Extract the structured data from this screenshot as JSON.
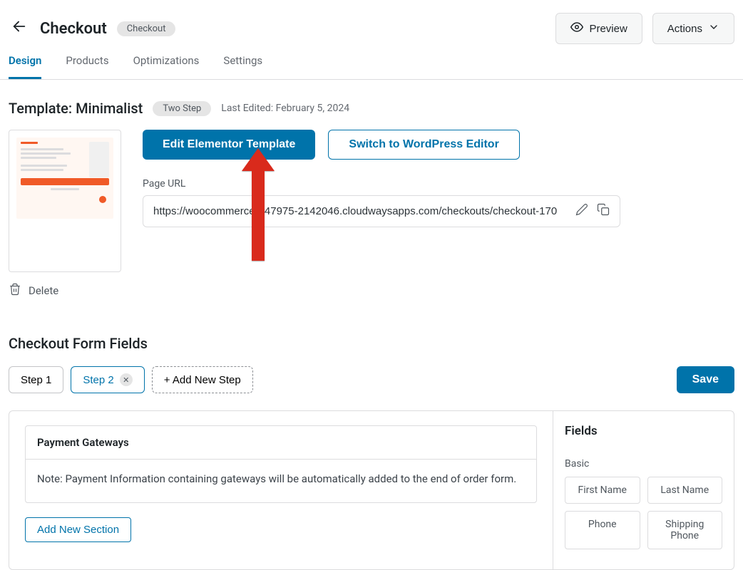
{
  "header": {
    "title": "Checkout",
    "badge": "Checkout",
    "preview_label": "Preview",
    "actions_label": "Actions"
  },
  "tabs": [
    "Design",
    "Products",
    "Optimizations",
    "Settings"
  ],
  "active_tab_index": 0,
  "template": {
    "title": "Template: Minimalist",
    "badge": "Two Step",
    "last_edited": "Last Edited: February 5, 2024",
    "edit_button": "Edit Elementor Template",
    "switch_button": "Switch to WordPress Editor",
    "page_url_label": "Page URL",
    "page_url_value": "https://woocommerce-547975-2142046.cloudwaysapps.com/checkouts/checkout-170",
    "delete_label": "Delete"
  },
  "form_fields": {
    "title": "Checkout Form Fields",
    "steps": [
      "Step 1",
      "Step 2"
    ],
    "active_step_index": 1,
    "add_step_label": "+ Add New Step",
    "save_label": "Save",
    "payment_gateways_title": "Payment Gateways",
    "payment_gateways_note": "Note: Payment Information containing gateways will be automatically added to the end of order form.",
    "add_section_label": "Add New Section",
    "fields_panel_title": "Fields",
    "fields_group": "Basic",
    "field_chips": [
      "First Name",
      "Last Name",
      "Phone",
      "Shipping Phone"
    ]
  }
}
